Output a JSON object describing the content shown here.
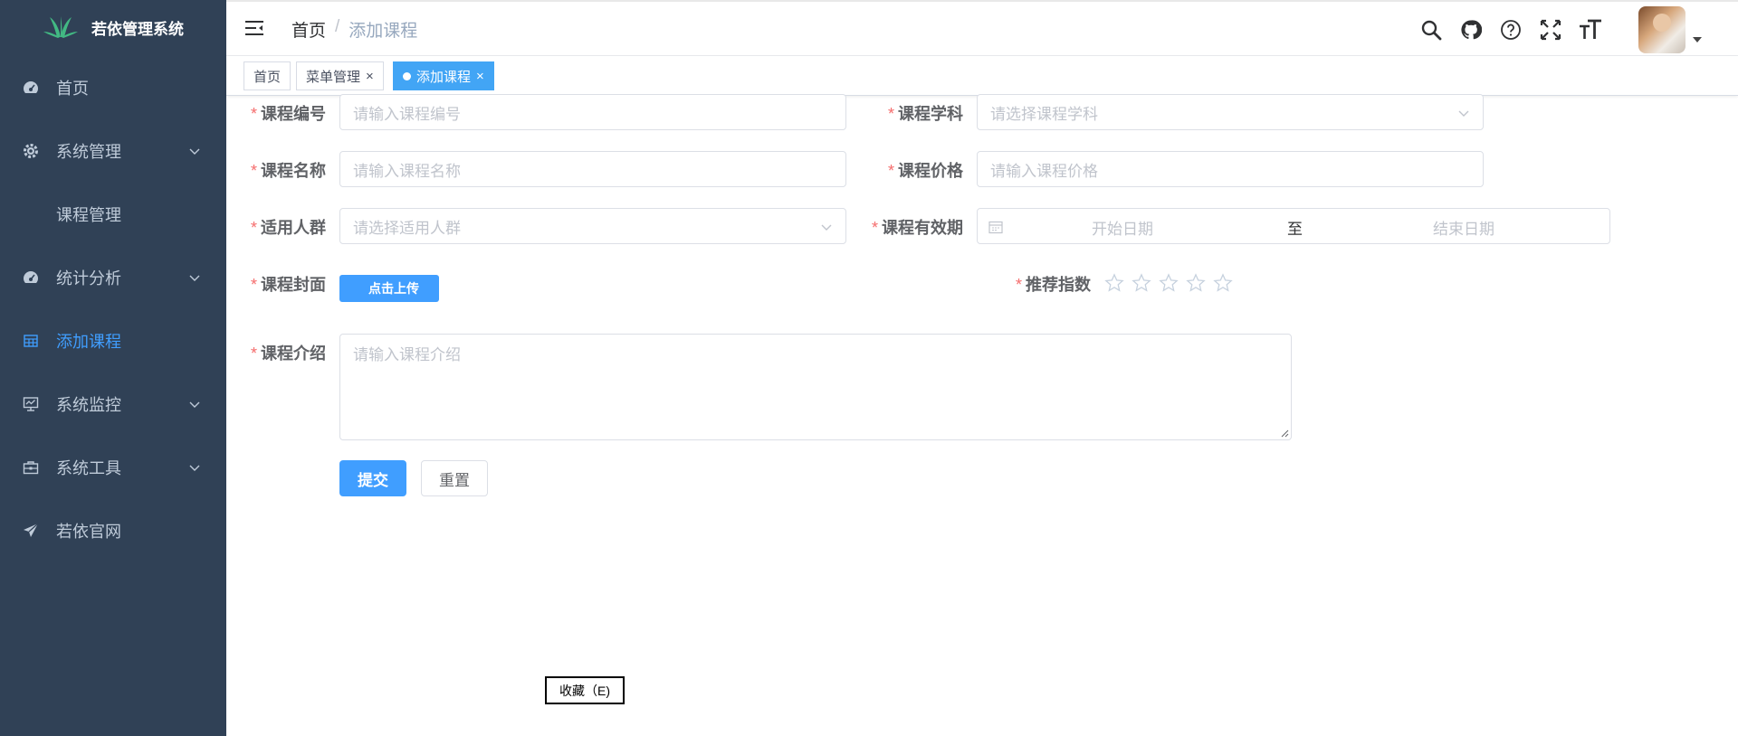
{
  "app": {
    "title": "若依管理系统"
  },
  "sidebar": {
    "items": [
      {
        "label": "首页",
        "icon": "dashboard-icon"
      },
      {
        "label": "系统管理",
        "icon": "gear-icon",
        "expandable": true
      },
      {
        "label": "课程管理",
        "sub": true
      },
      {
        "label": "统计分析",
        "icon": "dashboard-icon",
        "expandable": true
      },
      {
        "label": "添加课程",
        "icon": "grid-icon",
        "active": true
      },
      {
        "label": "系统监控",
        "icon": "monitor-icon",
        "expandable": true
      },
      {
        "label": "系统工具",
        "icon": "toolbox-icon",
        "expandable": true
      },
      {
        "label": "若依官网",
        "icon": "send-icon"
      }
    ]
  },
  "breadcrumb": {
    "home": "首页",
    "separator": "/",
    "current": "添加课程"
  },
  "header_icons": [
    "search-icon",
    "github-icon",
    "help-icon",
    "fullscreen-icon",
    "font-size-icon"
  ],
  "tags": [
    {
      "label": "首页"
    },
    {
      "label": "菜单管理",
      "close": "×"
    },
    {
      "label": "添加课程",
      "close": "×",
      "active": true
    }
  ],
  "form": {
    "course_code": {
      "label": "课程编号",
      "placeholder": "请输入课程编号"
    },
    "course_subject": {
      "label": "课程学科",
      "placeholder": "请选择课程学科"
    },
    "course_name": {
      "label": "课程名称",
      "placeholder": "请输入课程名称"
    },
    "course_price": {
      "label": "课程价格",
      "placeholder": "请输入课程价格"
    },
    "audience": {
      "label": "适用人群",
      "placeholder": "请选择适用人群"
    },
    "validity": {
      "label": "课程有效期",
      "start": "开始日期",
      "separator": "至",
      "end": "结束日期"
    },
    "cover": {
      "label": "课程封面",
      "button": "点击上传"
    },
    "rating": {
      "label": "推荐指数",
      "value": 0,
      "max": 5
    },
    "intro": {
      "label": "课程介绍",
      "placeholder": "请输入课程介绍"
    },
    "required_mark": "*",
    "submit": "提交",
    "reset": "重置"
  },
  "tooltip": {
    "text": "收藏（E)"
  },
  "colors": {
    "sidebar_bg": "#304156",
    "accent": "#409eff",
    "tag_active": "#42a5f5",
    "required": "#f56c6c"
  }
}
